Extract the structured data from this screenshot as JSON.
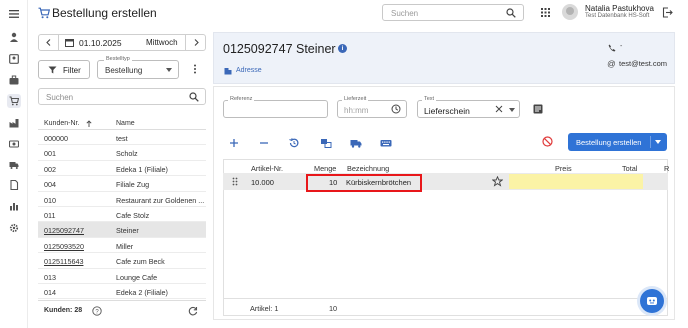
{
  "header": {
    "title": "Bestellung erstellen",
    "search_placeholder": "Suchen",
    "user_name": "Natalia Pastukhova",
    "user_company": "Test Datenbank HS-Soft"
  },
  "rail": {
    "icons": [
      "menu-icon",
      "person-icon",
      "contact-card-icon",
      "briefcase-icon",
      "cart-icon",
      "factory-icon",
      "money-icon",
      "truck-icon",
      "document-icon",
      "bar-chart-icon",
      "gear-icon"
    ],
    "active": "cart-icon"
  },
  "left": {
    "date": "01.10.2025",
    "weekday": "Mittwoch",
    "filter_label": "Filter",
    "bestelltyp_label": "Bestelltyp",
    "bestelltyp_value": "Bestellung",
    "search_placeholder": "Suchen",
    "col_kunden_nr": "Kunden-Nr.",
    "col_name": "Name",
    "customers": [
      {
        "nr": "000000",
        "name": "test"
      },
      {
        "nr": "001",
        "name": "Scholz"
      },
      {
        "nr": "002",
        "name": "Edeka 1 (Filiale)"
      },
      {
        "nr": "004",
        "name": "Filiale Zug"
      },
      {
        "nr": "010",
        "name": "Restaurant zur Goldenen ..."
      },
      {
        "nr": "011",
        "name": "Cafe Stolz"
      },
      {
        "nr": "0125092747",
        "name": "Steiner"
      },
      {
        "nr": "0125093520",
        "name": "Miller"
      },
      {
        "nr": "0125115643",
        "name": "Cafe zum Beck"
      },
      {
        "nr": "013",
        "name": "Lounge Cafe"
      },
      {
        "nr": "014",
        "name": "Edeka 2 (Filiale)"
      }
    ],
    "footer": "Kunden: 28"
  },
  "main": {
    "title": "0125092747 Steiner",
    "address_link": "Adresse",
    "phone": "-",
    "email": "test@test.com",
    "referenz_label": "Referenz",
    "lieferzeit_label": "Lieferzeit",
    "lieferzeit_placeholder": "hh:mm",
    "text_label": "Text",
    "text_value": "Lieferschein",
    "order_button": "Bestellung erstellen",
    "grid": {
      "col_artikel": "Artikel-Nr.",
      "col_menge": "Menge",
      "col_bez": "Bezeichnung",
      "col_preis": "Preis",
      "col_total": "Total",
      "col_r": "R",
      "row": {
        "artikel": "10.000",
        "menge": "10",
        "bezeichnung": "Kürbiskernbrötchen"
      },
      "footer_artikel": "Artikel: 1",
      "footer_menge": "10"
    }
  }
}
